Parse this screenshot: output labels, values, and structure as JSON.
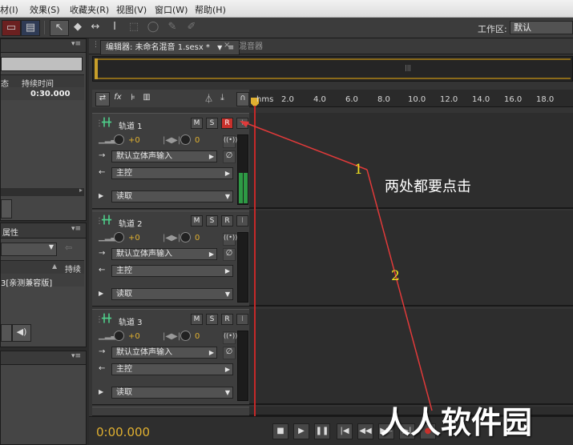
{
  "menu": [
    "材(I)",
    "效果(S)",
    "收藏夹(R)",
    "视图(V)",
    "窗口(W)",
    "帮助(H)"
  ],
  "toolbar": {
    "workspace_label": "工作区:",
    "workspace_value": "默认"
  },
  "files_panel": {
    "col_status": "态",
    "col_duration": "持续时间",
    "duration_value": "0:30.000"
  },
  "props_panel": {
    "tab_label": "属性",
    "col_duration": "持续",
    "row_text": "3[亲测兼容版]"
  },
  "editor": {
    "tab_editor": "编辑器: 未命名混音 1.sesx *",
    "tab_mixer": "混音器"
  },
  "ruler": {
    "unit": "hms",
    "ticks": [
      "2.0",
      "4.0",
      "6.0",
      "8.0",
      "10.0",
      "12.0",
      "14.0",
      "16.0",
      "18.0"
    ]
  },
  "tracks": [
    {
      "name": "轨道 1",
      "volume": "+0",
      "pan": "0",
      "input": "默认立体声输入",
      "output": "主控",
      "mode": "读取"
    },
    {
      "name": "轨道 2",
      "volume": "+0",
      "pan": "0",
      "input": "默认立体声输入",
      "output": "主控",
      "mode": "读取"
    },
    {
      "name": "轨道 3",
      "volume": "+0",
      "pan": "0",
      "input": "默认立体声输入",
      "output": "主控",
      "mode": "读取"
    }
  ],
  "track_buttons": {
    "mute": "M",
    "solo": "S",
    "record": "R",
    "input_monitor": "I"
  },
  "annotation": {
    "text": "两处都要点击",
    "marker1": "1",
    "marker2": "2",
    "color": "#e03a3a",
    "text_color": "#ffffff",
    "marker_color": "#f0e020"
  },
  "transport": {
    "time": "0:00.000"
  },
  "watermark": "人人软件园",
  "colors": {
    "record_active": "#c8312c",
    "timecode": "#e0b030",
    "playhead": "#c62828"
  }
}
